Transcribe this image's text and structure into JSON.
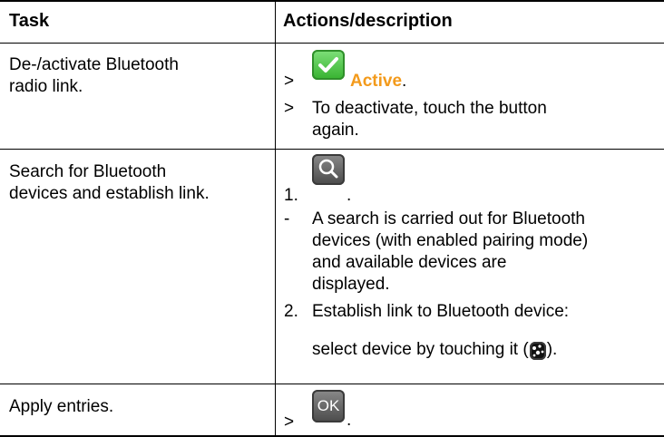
{
  "table": {
    "headers": {
      "task": "Task",
      "actions": "Actions/description"
    },
    "rows": [
      {
        "task_lines": [
          "De-/activate Bluetooth",
          "radio link."
        ],
        "steps": [
          {
            "marker": ">",
            "icon": "checkmark-icon",
            "label": "Active",
            "after": "."
          },
          {
            "marker": ">",
            "lines": [
              "To deactivate, touch the button",
              "again."
            ]
          }
        ]
      },
      {
        "task_lines": [
          "Search for Bluetooth",
          "devices and establish link."
        ],
        "steps": [
          {
            "marker": "1.",
            "icon": "search-icon",
            "after": "."
          },
          {
            "marker": "-",
            "lines": [
              "A search is carried out for Bluetooth",
              "devices (with enabled pairing mode)",
              "and available devices are",
              "displayed."
            ]
          },
          {
            "marker": "2.",
            "lines": [
              "Establish link to Bluetooth device:",
              "select device by touching it ("
            ],
            "icon": "bluetooth-device-icon",
            "after": ")."
          }
        ]
      },
      {
        "task_lines": [
          "Apply entries."
        ],
        "steps": [
          {
            "marker": ">",
            "icon": "ok-icon",
            "icon_text": "OK",
            "after": "."
          }
        ]
      }
    ]
  },
  "colors": {
    "accent_orange": "#f39a1b",
    "check_green": "#3fbf37",
    "button_grey": "#5a5a5a"
  }
}
